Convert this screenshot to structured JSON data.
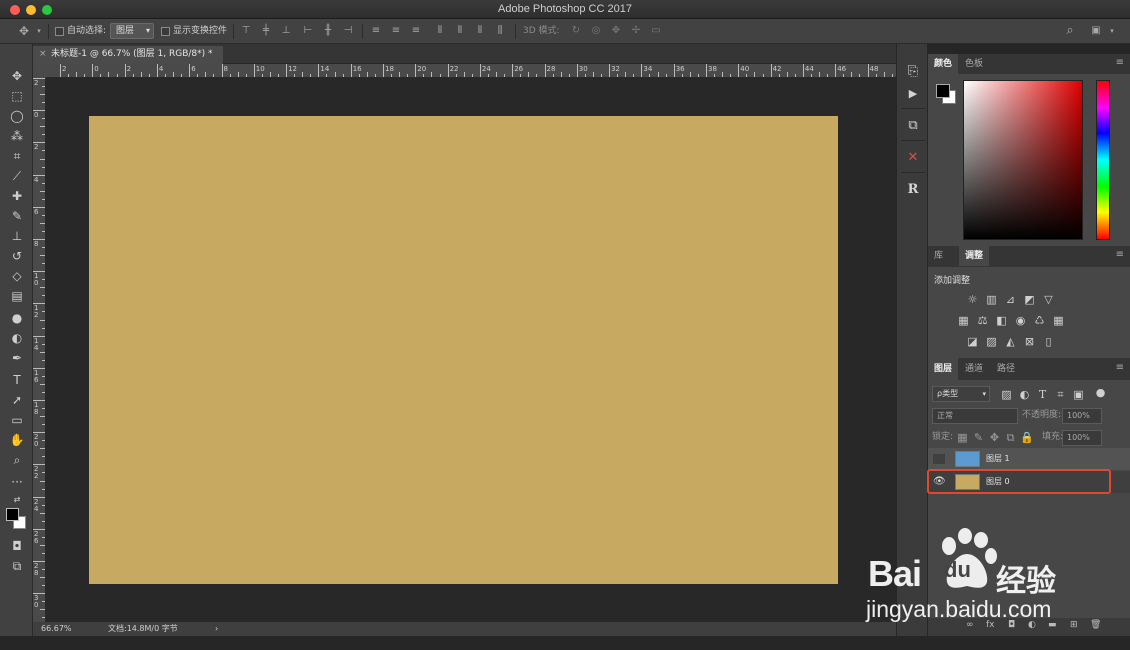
{
  "window": {
    "title": "Adobe Photoshop CC 2017"
  },
  "options_bar": {
    "auto_select_label": "自动选择:",
    "auto_select_value": "图层",
    "show_transform_label": "显示变换控件",
    "mode_3d_label": "3D 模式:"
  },
  "document": {
    "tab_title": "未标题-1 @ 66.7% (图层 1, RGB/8*) *",
    "close_glyph": "×"
  },
  "ruler": {
    "h_labels": [
      "2",
      "0",
      "2",
      "4",
      "6",
      "8",
      "10",
      "12",
      "14",
      "16",
      "18",
      "20",
      "22",
      "24",
      "26",
      "28",
      "30",
      "32",
      "34",
      "36",
      "38",
      "40",
      "42",
      "44",
      "46",
      "48",
      "50",
      "52"
    ],
    "v_labels": [
      "2",
      "0",
      "2",
      "4",
      "6",
      "8",
      "1\n0",
      "1\n2",
      "1\n4",
      "1\n6",
      "1\n8",
      "2\n0",
      "2\n2",
      "2\n4",
      "2\n6",
      "2\n8",
      "3\n0",
      "3\n2"
    ]
  },
  "canvas": {
    "fill_color": "#c7a961"
  },
  "status": {
    "zoom": "66.67%",
    "doc_info": "文档:14.8M/0 字节",
    "arrow": "›"
  },
  "color_panel": {
    "tabs": [
      "颜色",
      "色板"
    ],
    "fg": "#000000",
    "bg": "#ffffff"
  },
  "adjust_panel": {
    "tabs": [
      "库",
      "调整"
    ],
    "add_label": "添加调整"
  },
  "layers_panel": {
    "tabs": [
      "图层",
      "通道",
      "路径"
    ],
    "filter_label": "ρ类型",
    "blend_mode": "正常",
    "opacity_label": "不透明度:",
    "opacity_value": "100%",
    "lock_label": "锁定:",
    "fill_label": "填充:",
    "fill_value": "100%",
    "layers": [
      {
        "name": "图层 1",
        "color": "#5b9bd1",
        "visible": false
      },
      {
        "name": "图层 0",
        "color": "#c7a961",
        "visible": true
      }
    ]
  },
  "watermark": {
    "brand_left": "Bai",
    "brand_right": "du",
    "brand_cn": "经验",
    "url": "jingyan.baidu.com"
  }
}
